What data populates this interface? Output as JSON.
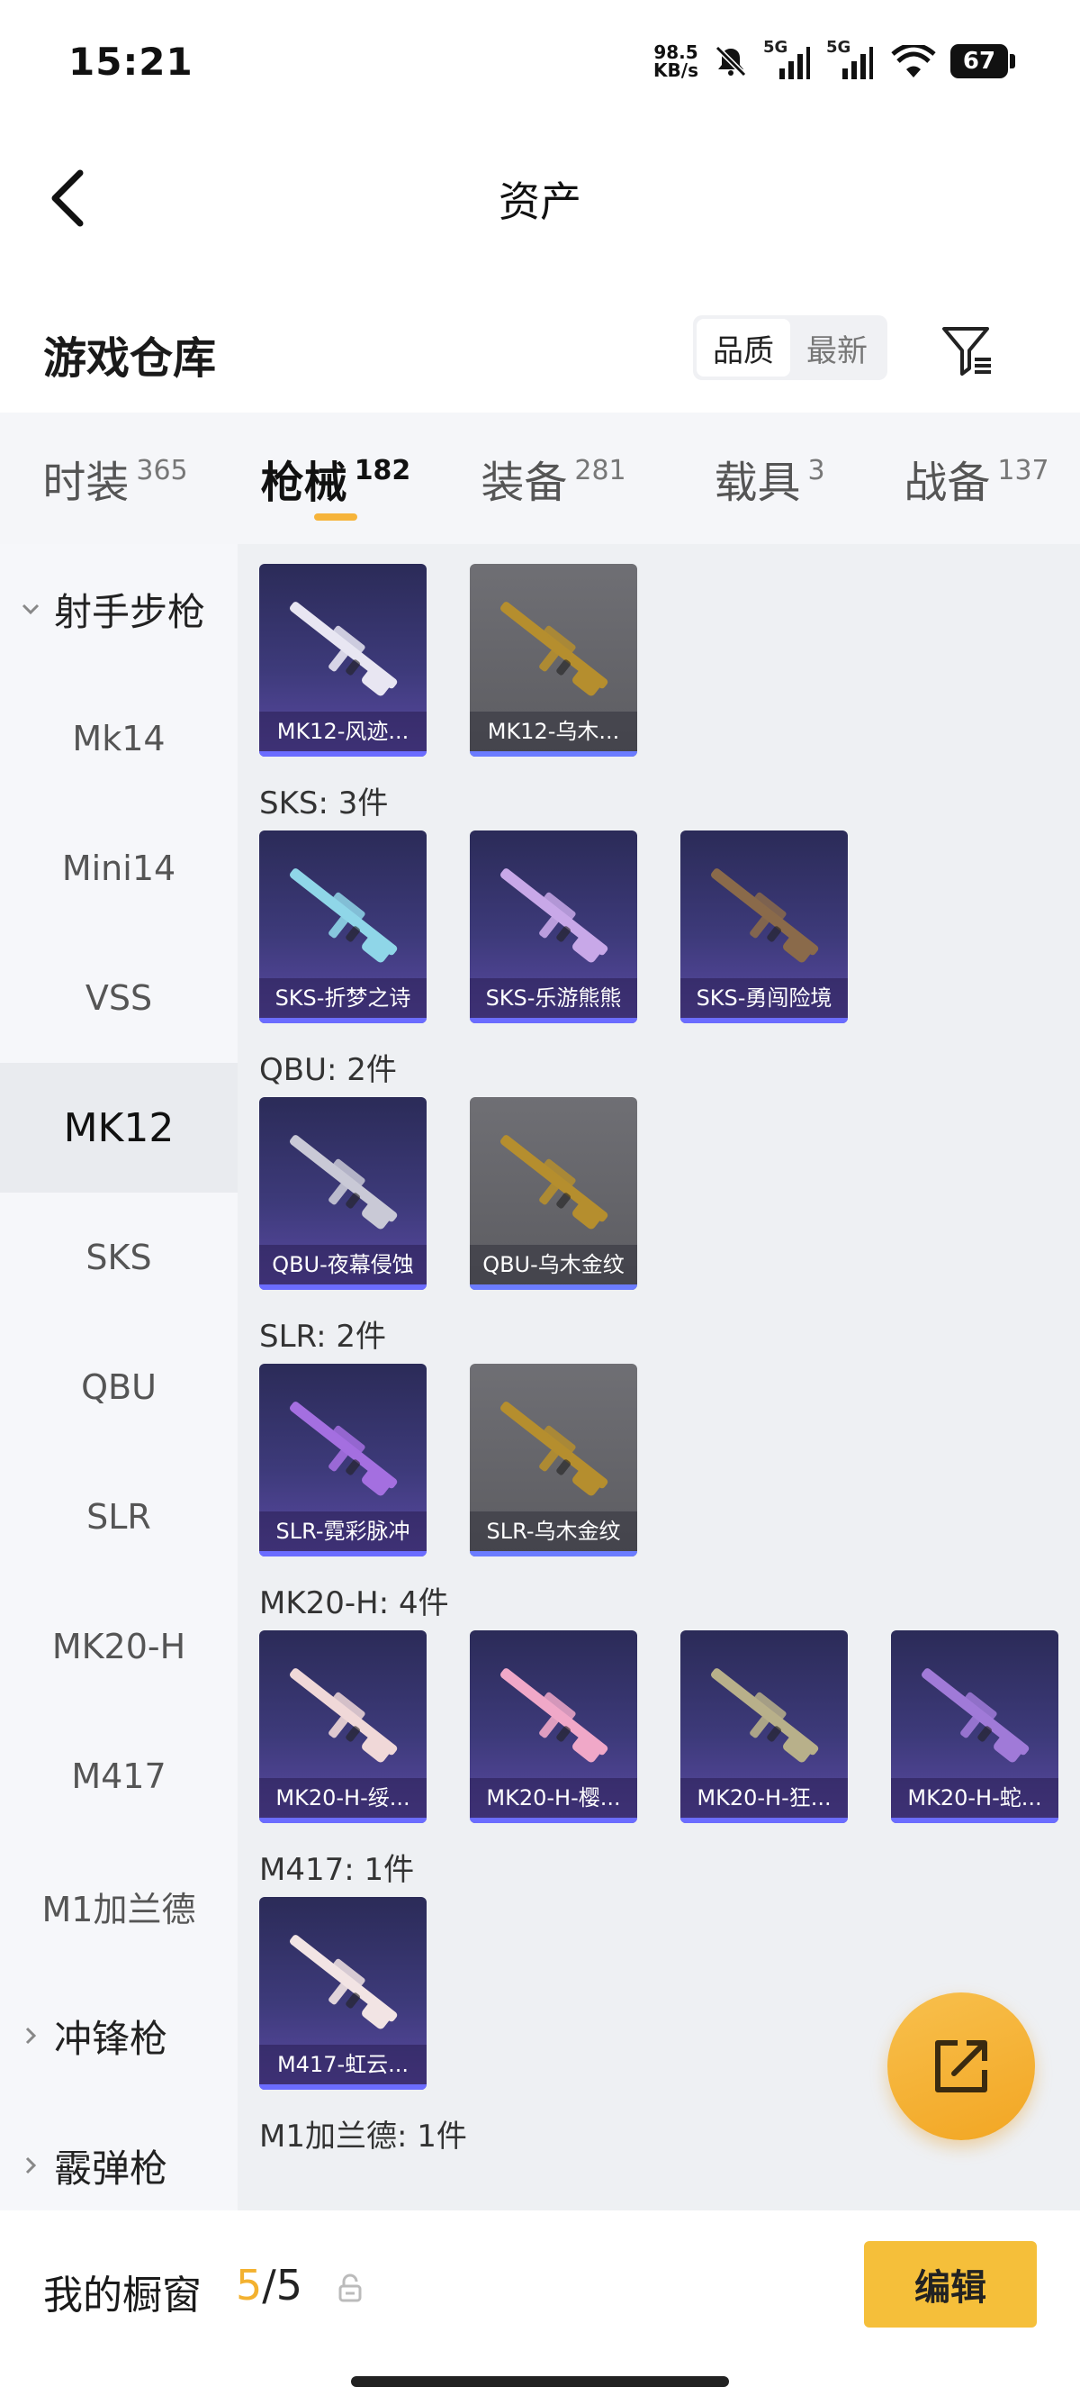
{
  "status_bar": {
    "time": "15:21",
    "speed_value": "98.5",
    "speed_unit": "KB/s",
    "signal1_label": "5G",
    "signal2_label": "5G",
    "battery": "67"
  },
  "header": {
    "title": "资产"
  },
  "warehouse": {
    "title": "游戏仓库",
    "sort_options": [
      {
        "label": "品质",
        "active": true
      },
      {
        "label": "最新",
        "active": false
      }
    ]
  },
  "tabs": [
    {
      "label": "时装",
      "count": "365",
      "active": false
    },
    {
      "label": "枪械",
      "count": "182",
      "active": true
    },
    {
      "label": "装备",
      "count": "281",
      "active": false
    },
    {
      "label": "载具",
      "count": "3",
      "active": false
    },
    {
      "label": "战备",
      "count": "137",
      "active": false
    }
  ],
  "sidebar": {
    "items": [
      {
        "label": "射手步枪",
        "type": "group-open"
      },
      {
        "label": "Mk14"
      },
      {
        "label": "Mini14"
      },
      {
        "label": "VSS"
      },
      {
        "label": "MK12",
        "active": true
      },
      {
        "label": "SKS"
      },
      {
        "label": "QBU"
      },
      {
        "label": "SLR"
      },
      {
        "label": "MK20-H"
      },
      {
        "label": "M417"
      },
      {
        "label": "M1加兰德"
      },
      {
        "label": "冲锋枪",
        "type": "group-closed"
      },
      {
        "label": "霰弹枪",
        "type": "group-closed"
      }
    ]
  },
  "content": {
    "sections": [
      {
        "label": "",
        "items": [
          {
            "name": "MK12-风迹...",
            "style": "purple",
            "color": "#e8e6f2"
          },
          {
            "name": "MK12-乌木...",
            "style": "gray",
            "color": "#b58e2e"
          }
        ]
      },
      {
        "label": "SKS: 3件",
        "items": [
          {
            "name": "SKS-折梦之诗",
            "style": "purple",
            "color": "#8fd6e8"
          },
          {
            "name": "SKS-乐游熊熊",
            "style": "purple",
            "color": "#c8a8e8"
          },
          {
            "name": "SKS-勇闯险境",
            "style": "purple",
            "color": "#8a6a4a"
          }
        ]
      },
      {
        "label": "QBU: 2件",
        "items": [
          {
            "name": "QBU-夜幕侵蚀",
            "style": "purple",
            "color": "#c9c9d6"
          },
          {
            "name": "QBU-乌木金纹",
            "style": "gray",
            "color": "#b58e2e"
          }
        ]
      },
      {
        "label": "SLR: 2件",
        "items": [
          {
            "name": "SLR-霓彩脉冲",
            "style": "purple",
            "color": "#a46fe0"
          },
          {
            "name": "SLR-乌木金纹",
            "style": "gray",
            "color": "#b58e2e"
          }
        ]
      },
      {
        "label": "MK20-H: 4件",
        "items": [
          {
            "name": "MK20-H-绥...",
            "style": "purple",
            "color": "#f0d8d8"
          },
          {
            "name": "MK20-H-樱...",
            "style": "purple",
            "color": "#f0a8c8"
          },
          {
            "name": "MK20-H-狂...",
            "style": "purple",
            "color": "#b8b08a"
          },
          {
            "name": "MK20-H-蛇...",
            "style": "purple",
            "color": "#a07ad8"
          }
        ]
      },
      {
        "label": "M417: 1件",
        "items": [
          {
            "name": "M417-虹云...",
            "style": "purple",
            "color": "#f2e4e4"
          }
        ]
      },
      {
        "label": "M1加兰德: 1件",
        "items": []
      }
    ]
  },
  "footer": {
    "label": "我的橱窗",
    "count_current": "5",
    "count_sep": "/",
    "count_total": "5",
    "edit_label": "编辑"
  }
}
